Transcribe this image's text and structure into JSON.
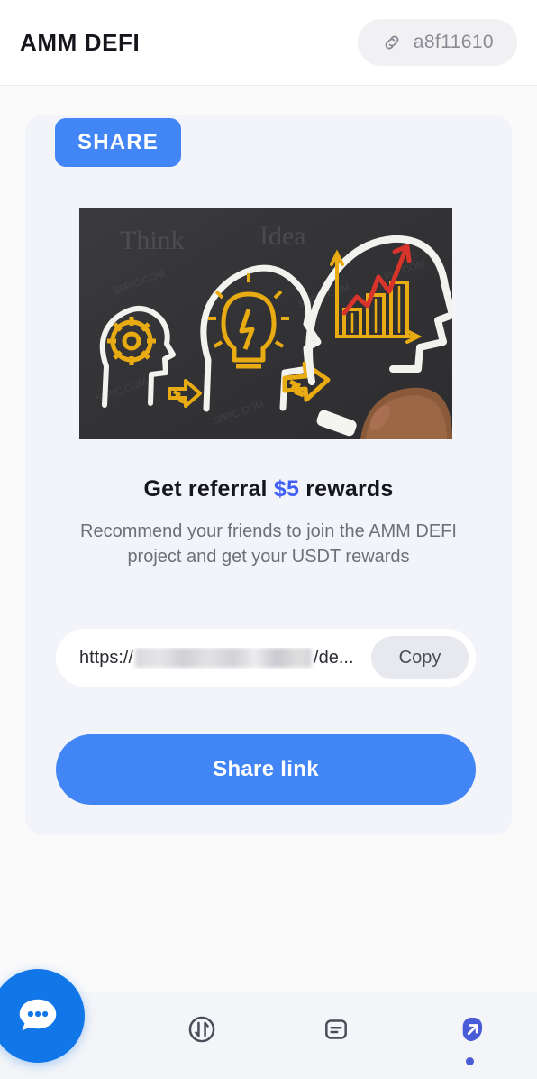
{
  "header": {
    "brand": "AMM DEFI",
    "account_icon": "link-chain-icon",
    "account_id": "a8f11610"
  },
  "card": {
    "tab_label": "SHARE",
    "hero_image": {
      "alt": "chalkboard-illustration-three-heads-gear-lightbulb-growth-chart",
      "background_color": "#37373a",
      "chalk_color": "#f2f2ee",
      "accent_color": "#e8ab12",
      "arrow_color": "#d9342b"
    },
    "headline_prefix": "Get referral ",
    "headline_amount": "$5",
    "headline_suffix": " rewards",
    "subtext": "Recommend your friends to join the AMM DEFI project and get your USDT rewards",
    "link_prefix": "https://",
    "link_redacted": "redacted-blurred-segment",
    "link_suffix": "/de...",
    "copy_label": "Copy",
    "share_label": "Share link"
  },
  "bottom_nav": {
    "chat_fab_icon": "chat-bubble-icon",
    "items": [
      {
        "icon": "home-icon",
        "active": false
      },
      {
        "icon": "swap-transfer-icon",
        "active": false
      },
      {
        "icon": "document-list-icon",
        "active": false
      },
      {
        "icon": "share-arrow-icon",
        "active": true
      }
    ]
  },
  "colors": {
    "page_bg": "#fafafb",
    "card_bg": "#f2f4f9",
    "primary_blue": "#4285f4",
    "accent_blue": "#4060f5",
    "active_nav": "#4a5bd8",
    "fab_blue": "#1177e8",
    "muted_text": "#6d7078"
  }
}
